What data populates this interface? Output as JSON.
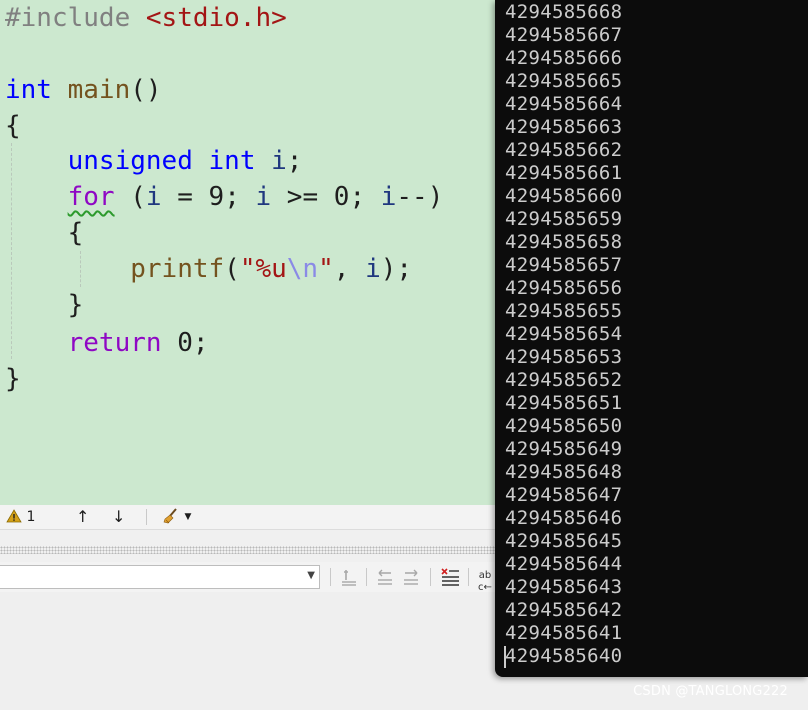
{
  "editor": {
    "lines": [
      {
        "tokens": [
          {
            "t": "#include ",
            "c": "#808080"
          },
          {
            "t": "<stdio.h>",
            "c": "#a31515"
          }
        ]
      },
      {
        "tokens": []
      },
      {
        "tokens": [
          {
            "t": "int",
            "c": "#0000ff"
          },
          {
            "t": " ",
            "c": "#1e1e1e"
          },
          {
            "t": "main",
            "c": "#74531f"
          },
          {
            "t": "()",
            "c": "#1e1e1e"
          }
        ]
      },
      {
        "tokens": [
          {
            "t": "{",
            "c": "#1e1e1e"
          }
        ]
      },
      {
        "tokens": [
          {
            "t": "    ",
            "c": "#1e1e1e"
          },
          {
            "t": "unsigned",
            "c": "#0000ff"
          },
          {
            "t": " ",
            "c": "#1e1e1e"
          },
          {
            "t": "int",
            "c": "#0000ff"
          },
          {
            "t": " ",
            "c": "#1e1e1e"
          },
          {
            "t": "i",
            "c": "#1f377f"
          },
          {
            "t": ";",
            "c": "#1e1e1e"
          }
        ]
      },
      {
        "tokens": [
          {
            "t": "    ",
            "c": "#1e1e1e"
          },
          {
            "t": "for",
            "c": "#8f08c4",
            "squiggle": true
          },
          {
            "t": " (",
            "c": "#1e1e1e"
          },
          {
            "t": "i",
            "c": "#1f377f"
          },
          {
            "t": " = ",
            "c": "#1e1e1e"
          },
          {
            "t": "9",
            "c": "#1e1e1e"
          },
          {
            "t": "; ",
            "c": "#1e1e1e"
          },
          {
            "t": "i",
            "c": "#1f377f"
          },
          {
            "t": " >= ",
            "c": "#1e1e1e"
          },
          {
            "t": "0",
            "c": "#1e1e1e"
          },
          {
            "t": "; ",
            "c": "#1e1e1e"
          },
          {
            "t": "i",
            "c": "#1f377f"
          },
          {
            "t": "--)",
            "c": "#1e1e1e"
          }
        ]
      },
      {
        "tokens": [
          {
            "t": "    ",
            "c": "#1e1e1e"
          },
          {
            "t": "{",
            "c": "#1e1e1e"
          }
        ]
      },
      {
        "tokens": [
          {
            "t": "        ",
            "c": "#1e1e1e"
          },
          {
            "t": "printf",
            "c": "#74531f"
          },
          {
            "t": "(",
            "c": "#1e1e1e"
          },
          {
            "t": "\"%u",
            "c": "#a31515"
          },
          {
            "t": "\\n",
            "c": "#8a8ae6"
          },
          {
            "t": "\"",
            "c": "#a31515"
          },
          {
            "t": ", ",
            "c": "#1e1e1e"
          },
          {
            "t": "i",
            "c": "#1f377f"
          },
          {
            "t": ");",
            "c": "#1e1e1e"
          }
        ]
      },
      {
        "tokens": [
          {
            "t": "    ",
            "c": "#1e1e1e"
          },
          {
            "t": "}",
            "c": "#1e1e1e"
          }
        ]
      },
      {
        "tokens": [
          {
            "t": "    ",
            "c": "#1e1e1e"
          },
          {
            "t": "return",
            "c": "#8f08c4"
          },
          {
            "t": " ",
            "c": "#1e1e1e"
          },
          {
            "t": "0",
            "c": "#1e1e1e"
          },
          {
            "t": ";",
            "c": "#1e1e1e"
          }
        ]
      },
      {
        "tokens": [
          {
            "t": "}",
            "c": "#1e1e1e"
          }
        ]
      }
    ]
  },
  "error_bar": {
    "warning_count": "1",
    "warning_icon": "warning-triangle-icon",
    "up_icon": "arrow-up-icon",
    "down_icon": "arrow-down-icon",
    "cleanup_icon": "broom-icon"
  },
  "console": {
    "lines": [
      "4294585668",
      "4294585667",
      "4294585666",
      "4294585665",
      "4294585664",
      "4294585663",
      "4294585662",
      "4294585661",
      "4294585660",
      "4294585659",
      "4294585658",
      "4294585657",
      "4294585656",
      "4294585655",
      "4294585654",
      "4294585653",
      "4294585652",
      "4294585651",
      "4294585650",
      "4294585649",
      "4294585648",
      "4294585647",
      "4294585646",
      "4294585645",
      "4294585644",
      "4294585643",
      "4294585642",
      "4294585641",
      "4294585640"
    ]
  },
  "watermark": "CSDN @TANGLONG222",
  "colors": {
    "editor_bg": "#cce8cf",
    "console_bg": "#0c0c0c",
    "console_text": "#cccccc",
    "keyword": "#0000ff",
    "control_keyword": "#8f08c4",
    "string": "#a31515",
    "function": "#74531f",
    "variable": "#1f377f",
    "warning": "#d4a017"
  }
}
